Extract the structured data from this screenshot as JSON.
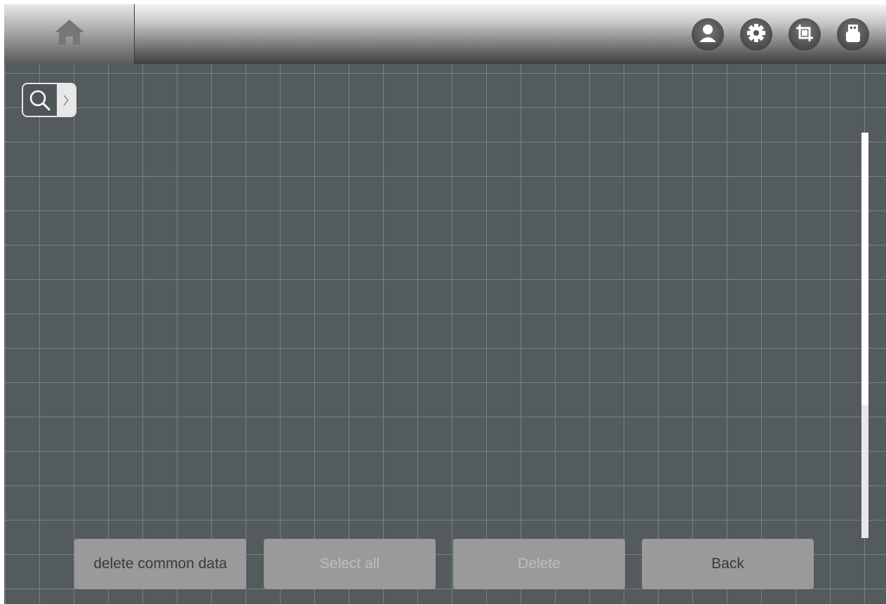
{
  "header": {
    "home_icon": "home-icon",
    "icons": [
      "user-icon",
      "gear-icon",
      "crop-icon",
      "usb-icon"
    ]
  },
  "search": {
    "icon": "search-icon",
    "expand_icon": "chevron-right-icon"
  },
  "footer": {
    "delete_common_label": "delete common data",
    "select_all_label": "Select all",
    "delete_label": "Delete",
    "back_label": "Back"
  },
  "colors": {
    "background": "#545b5d",
    "grid_line": "#969ea0",
    "button": "#9a9a9a",
    "button_text_active": "#3a3a3a",
    "button_text_disabled": "#bdbdbd"
  }
}
